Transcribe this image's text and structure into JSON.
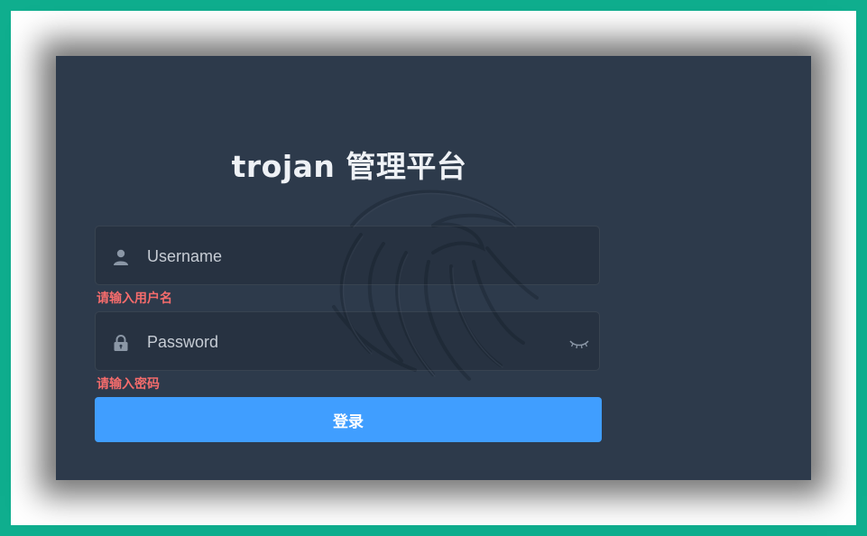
{
  "app": {
    "title": "trojan 管理平台"
  },
  "login_form": {
    "username": {
      "value": "",
      "placeholder": "Username",
      "icon": "user-icon",
      "error": "请输入用户名"
    },
    "password": {
      "value": "",
      "placeholder": "Password",
      "icon": "lock-icon",
      "toggle_icon": "eye-closed-icon",
      "error": "请输入密码"
    },
    "submit_label": "登录"
  },
  "colors": {
    "page_border": "#0fae8e",
    "panel_bg": "#2d3a4b",
    "button_bg": "#409eff",
    "error_text": "#f56c6c",
    "title_text": "#eef1f5"
  }
}
